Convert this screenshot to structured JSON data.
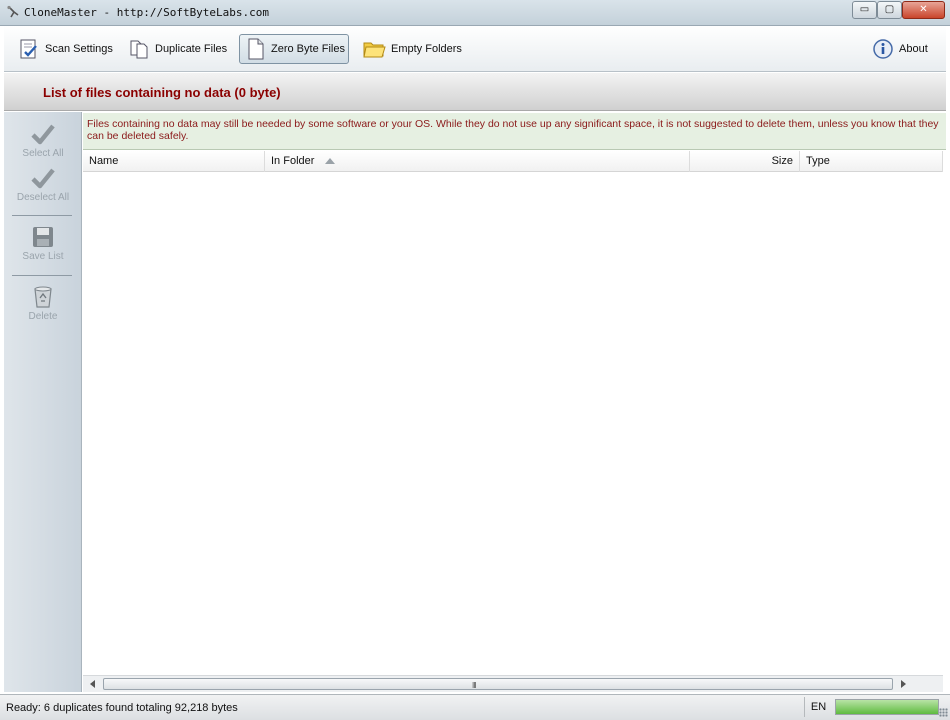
{
  "window": {
    "title": "CloneMaster - http://SoftByteLabs.com",
    "min_glyph": "▭",
    "max_glyph": "▢",
    "close_glyph": "✕"
  },
  "toolbar": {
    "items": [
      {
        "label": "Scan Settings",
        "icon": "scan-settings-icon"
      },
      {
        "label": "Duplicate Files",
        "icon": "duplicate-files-icon"
      },
      {
        "label": "Zero Byte Files",
        "icon": "zero-byte-file-icon",
        "active": true
      },
      {
        "label": "Empty Folders",
        "icon": "folder-icon"
      }
    ],
    "about_label": "About"
  },
  "heading": {
    "title": "List of files containing no data (0 byte)"
  },
  "sidebar": {
    "items": [
      {
        "label": "Select All",
        "icon": "checkmark-icon",
        "enabled": false
      },
      {
        "label": "Deselect All",
        "icon": "checkmark-icon",
        "enabled": false
      },
      {
        "label": "Save List",
        "icon": "floppy-disk-icon",
        "enabled": false
      },
      {
        "label": "Delete",
        "icon": "recycle-bin-icon",
        "enabled": false
      }
    ]
  },
  "info": {
    "message": "Files containing no data may still be needed by some software or your OS. While they do not use up any significant space, it is not suggested to delete them, unless you know that they can be deleted safely."
  },
  "table": {
    "columns": [
      {
        "key": "name",
        "label": "Name"
      },
      {
        "key": "folder",
        "label": "In Folder",
        "sorted": "ascending"
      },
      {
        "key": "size",
        "label": "Size"
      },
      {
        "key": "type",
        "label": "Type"
      }
    ],
    "rows": []
  },
  "scrollbar": {
    "grip": "III"
  },
  "status": {
    "text": "Ready:  6 duplicates found totaling 92,218 bytes",
    "language": "EN",
    "progress_fraction": 1.0
  },
  "colors": {
    "heading_text": "#8b0000",
    "info_text": "#8b1a1a",
    "info_background": "#e6f0e2",
    "progress_fill": "#5fbb3f"
  }
}
